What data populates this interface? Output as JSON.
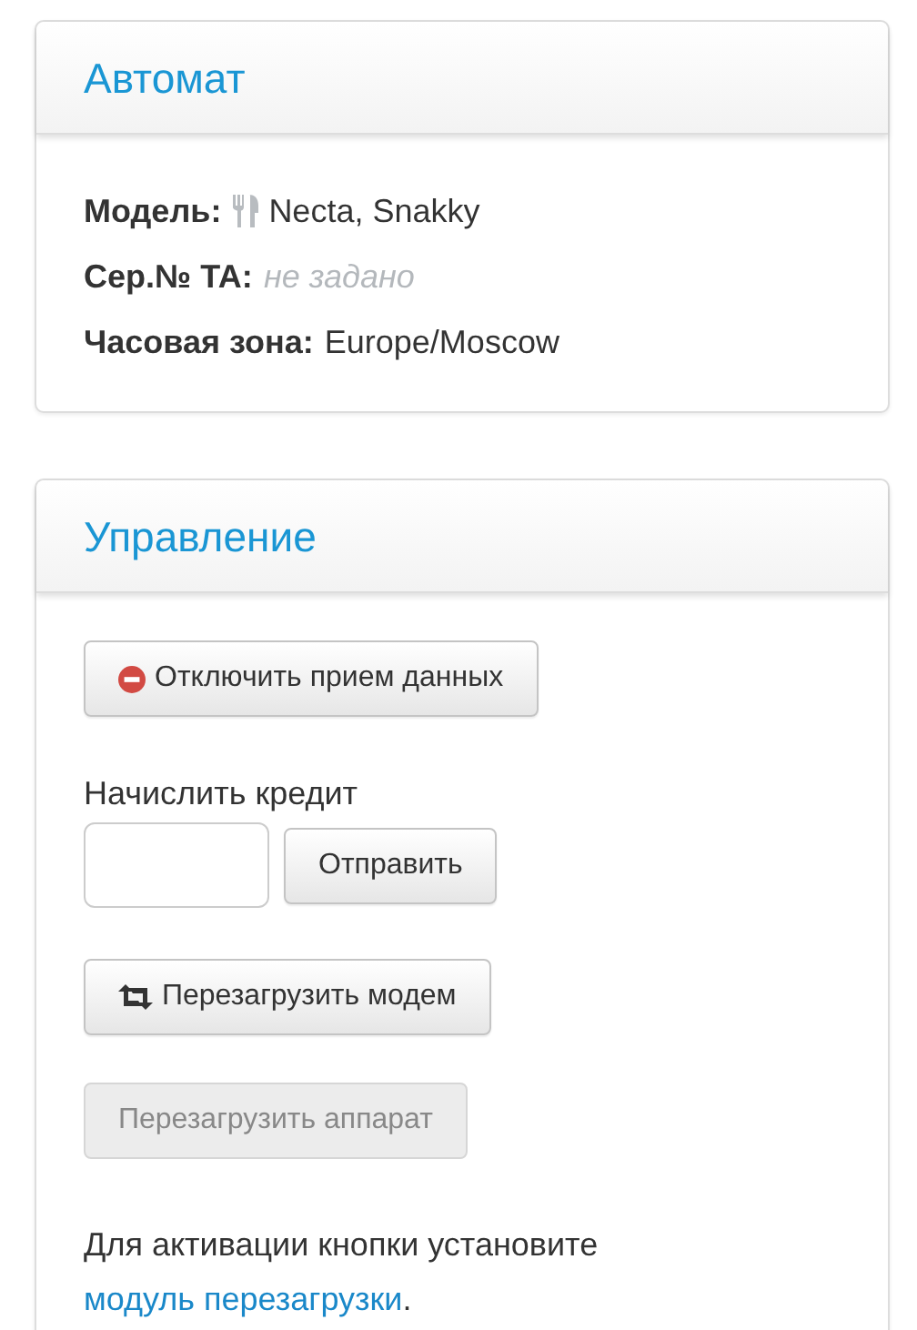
{
  "machine": {
    "title": "Автомат",
    "fields": [
      {
        "kind": "model",
        "label": "Модель:",
        "value": "Necta, Snakky"
      },
      {
        "kind": "unset",
        "label": "Сер.№ ТА:",
        "value": "не задано"
      },
      {
        "kind": "plain",
        "label": "Часовая зона:",
        "value": "Europe/Moscow"
      }
    ]
  },
  "control": {
    "title": "Управление",
    "items": [
      {
        "kind": "stop-button",
        "label": "Отключить прием данных",
        "disabled": false
      },
      {
        "kind": "credit",
        "label": "Начислить кредит",
        "button": "Отправить",
        "disabled": false
      },
      {
        "kind": "reload-button",
        "label": "Перезагрузить модем",
        "disabled": false
      },
      {
        "kind": "plain-button",
        "label": "Перезагрузить аппарат",
        "disabled": true
      },
      {
        "kind": "note",
        "text": "Для активации кнопки установите",
        "link": "модуль перезагрузки",
        "after": "."
      }
    ]
  }
}
